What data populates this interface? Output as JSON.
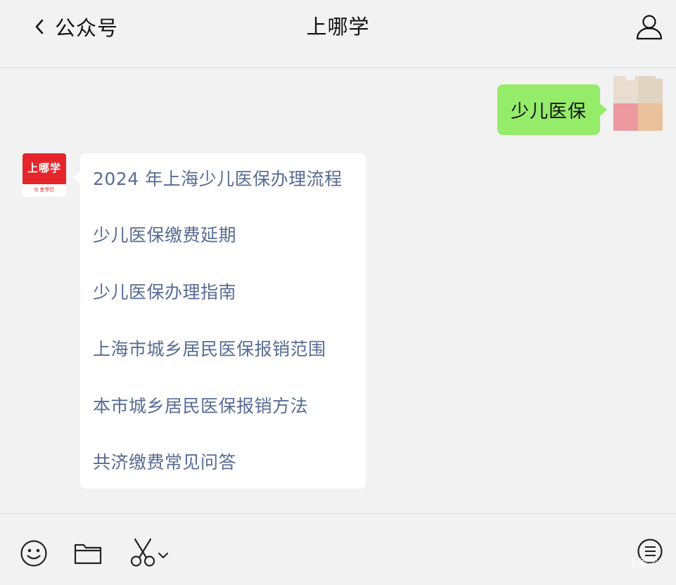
{
  "header": {
    "back_label": "公众号",
    "title": "上哪学"
  },
  "outgoing": {
    "text": "少儿医保",
    "bubble_color": "#95ec69"
  },
  "bot": {
    "avatar_brand": "上哪学",
    "avatar_sub": "Q 查学历",
    "brand_color": "#e4262c"
  },
  "reply_links": [
    "2024 年上海少儿医保办理流程",
    "少儿医保缴费延期",
    "少儿医保办理指南",
    "上海市城乡居民医保报销范围",
    "本市城乡居民医保报销方法",
    "共济缴费常见问答"
  ],
  "link_color": "#576b95",
  "toolbar": {
    "icons": [
      "emoji-icon",
      "folder-icon",
      "scissors-icon",
      "chevron-down-icon",
      "menu-list-icon"
    ]
  },
  "watermark": "上哪学"
}
